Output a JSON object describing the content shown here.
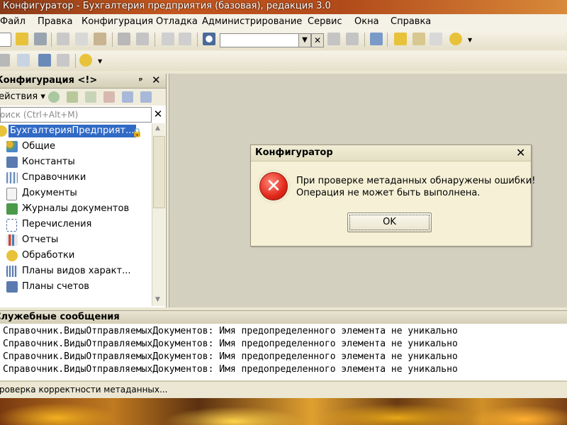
{
  "window": {
    "title": "Конфигуратор - Бухгалтерия предприятия (базовая), редакция 3.0"
  },
  "menu": {
    "items": [
      "Файл",
      "Правка",
      "Конфигурация",
      "Отладка",
      "Администрирование",
      "Сервис",
      "Окна",
      "Справка"
    ]
  },
  "toolbar": {
    "search_value": ""
  },
  "config_panel": {
    "title": "Конфигурация <!>",
    "actions_label": "Действия ▾",
    "search_placeholder": "Поиск (Ctrl+Alt+M)",
    "tree": {
      "root": "БухгалтерияПредприят...",
      "items": [
        "Общие",
        "Константы",
        "Справочники",
        "Документы",
        "Журналы документов",
        "Перечисления",
        "Отчеты",
        "Обработки",
        "Планы видов характ...",
        "Планы счетов"
      ]
    }
  },
  "dialog": {
    "title": "Конфигуратор",
    "message_line1": "При проверке метаданных обнаружены ошибки!",
    "message_line2": "Операция не может быть выполнена.",
    "ok_label": "OK"
  },
  "messages_panel": {
    "title": "Служебные сообщения",
    "lines": [
      "Справочник.ВидыОтправляемыхДокументов: Имя предопределенного элемента не уникально",
      "Справочник.ВидыОтправляемыхДокументов: Имя предопределенного элемента не уникально",
      "Справочник.ВидыОтправляемыхДокументов: Имя предопределенного элемента не уникально",
      "Справочник.ВидыОтправляемыхДокументов: Имя предопределенного элемента не уникально"
    ]
  },
  "status_bar": {
    "text": "Проверка корректности метаданных..."
  },
  "icons": {
    "error": "error-x-icon",
    "tree": [
      "common-icon",
      "constants-icon",
      "catalogs-icon",
      "documents-icon",
      "journals-icon",
      "enums-icon",
      "reports-icon",
      "processors-icon",
      "characteristics-icon",
      "accounts-icon"
    ]
  },
  "colors": {
    "title_bar": "#c4561e",
    "selection": "#316ac5",
    "error": "#e0281a",
    "dialog_bg": "#f6f1d6"
  }
}
